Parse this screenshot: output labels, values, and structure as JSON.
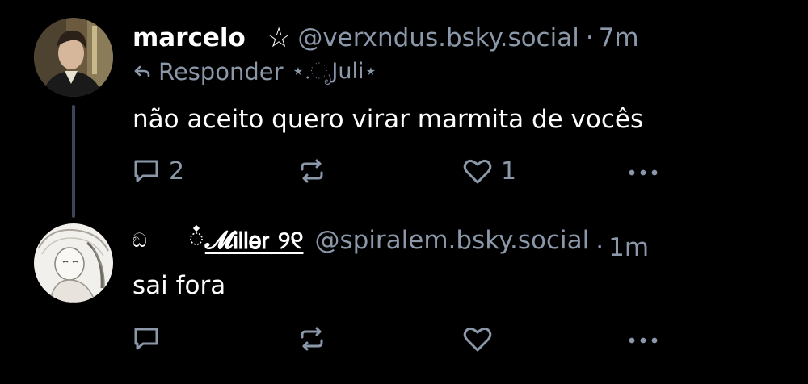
{
  "posts": [
    {
      "display_name": "marcelo",
      "name_symbol": "☆",
      "handle": "@verxndus.bsky.social",
      "separator": "·",
      "time": "7m",
      "reply_to": {
        "label": "Responder",
        "target": "⋆.ೃJuli⋆"
      },
      "text": "não aceito quero virar marmita de vocês",
      "actions": {
        "reply_count": "2",
        "repost_count": "",
        "like_count": "1"
      }
    },
    {
      "display_name_prefix": "ඞ",
      "display_name": "𝓜𝗂𝗅𝗅𝖾𝗋 ୨୧",
      "handle": "@spiralem.bsky.social",
      "separator": "·",
      "time": "1m",
      "text": "sai fora",
      "actions": {
        "reply_count": "",
        "repost_count": "",
        "like_count": ""
      }
    }
  ],
  "colors": {
    "background": "#000000",
    "text": "#ffffff",
    "muted": "#8b98a9",
    "thread_line": "#3a4658"
  },
  "icons": [
    "reply-arrow-icon",
    "comment-icon",
    "repost-icon",
    "heart-icon",
    "more-icon"
  ]
}
